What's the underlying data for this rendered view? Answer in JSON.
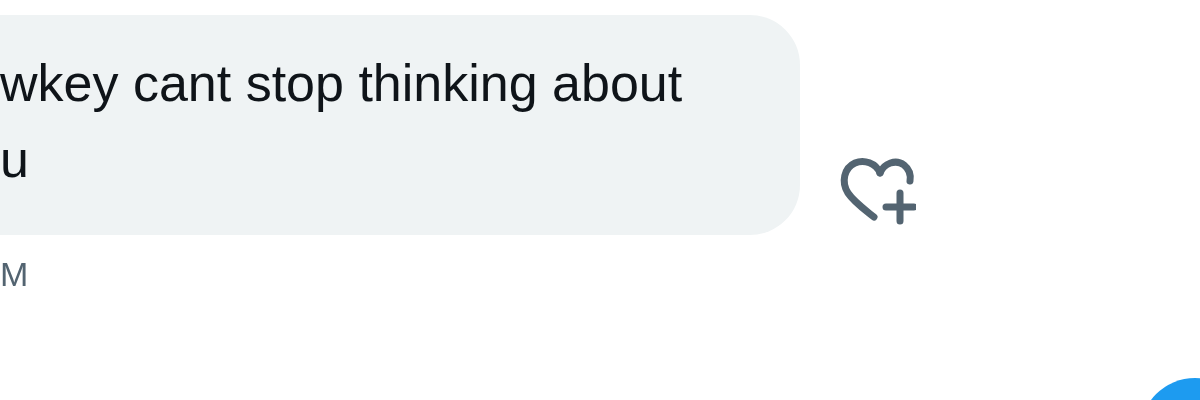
{
  "message": {
    "text": "wkey cant stop thinking about u",
    "time": "M"
  }
}
